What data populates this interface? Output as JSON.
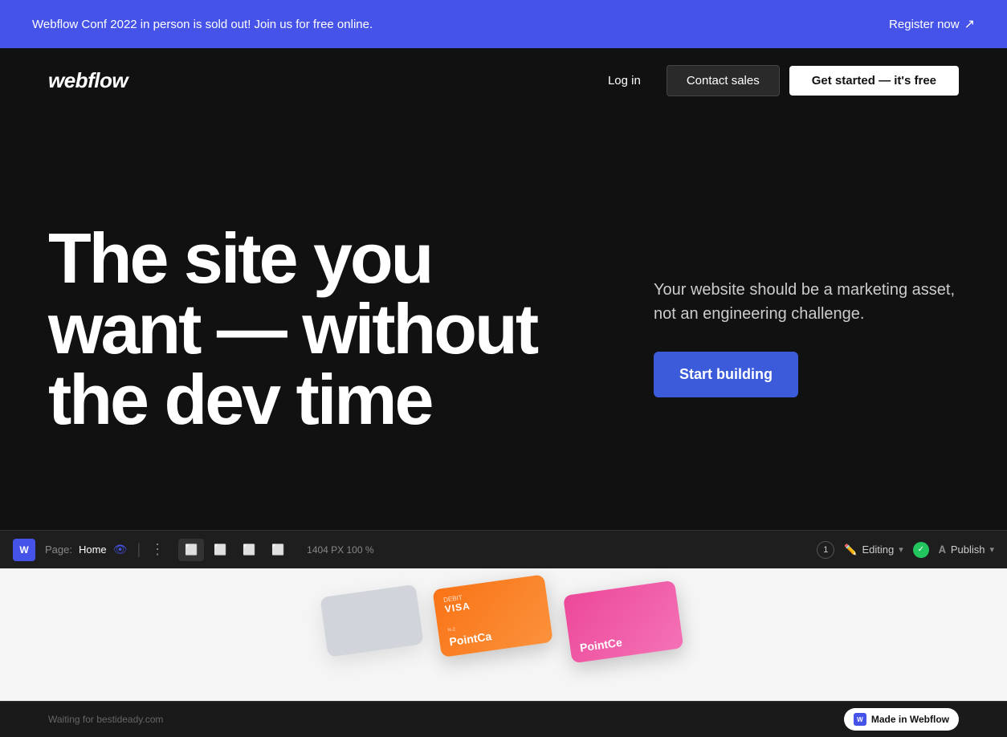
{
  "announcement": {
    "text": "Webflow Conf 2022 in person is sold out! Join us for free online.",
    "register_label": "Register now",
    "arrow": "↗"
  },
  "navbar": {
    "logo": "webflow",
    "login_label": "Log in",
    "contact_label": "Contact sales",
    "get_started_label": "Get started — it's free"
  },
  "hero": {
    "title_line1": "The site you",
    "title_line2": "want — without",
    "title_line3": "the dev time",
    "subtitle": "Your website should be a marketing asset, not an engineering challenge.",
    "cta_label": "Start building"
  },
  "editor": {
    "logo": "W",
    "page_label": "Page:",
    "page_name": "Home",
    "dots": "⋮",
    "dims": "1404 PX  100 %",
    "badge_num": "1",
    "editing_label": "Editing",
    "publish_label": "Publish"
  },
  "preview": {
    "card1_label": "DEBIT",
    "card1_type": "VISA",
    "card1_brand": "PointCa",
    "card1_num": "N-2",
    "card2_brand": "PointCe"
  },
  "bottom": {
    "waiting_text": "Waiting for bestideady.com",
    "made_in": "Made in Webflow"
  },
  "colors": {
    "accent": "#4553e8",
    "cta_blue": "#3b5bdb",
    "bg_dark": "#111111",
    "green": "#22c55e"
  }
}
